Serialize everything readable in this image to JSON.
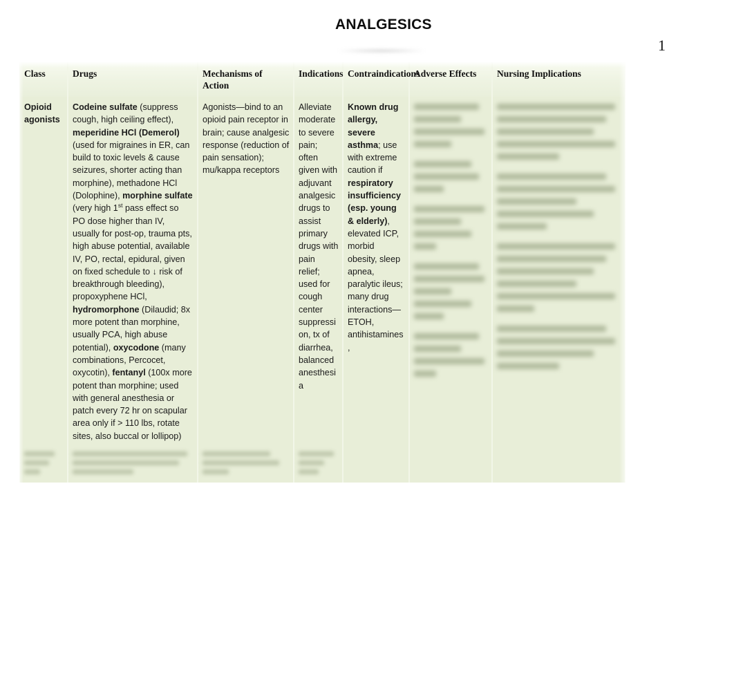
{
  "document": {
    "title": "ANALGESICS",
    "page_number": "1"
  },
  "table": {
    "headers": [
      "Class",
      "Drugs",
      "Mechanisms of Action",
      "Indications",
      "Contraindications",
      "Adverse Effects",
      "Nursing Implications"
    ],
    "rows": [
      {
        "class": "Opioid agonists",
        "drugs_segments": [
          {
            "text": "Codeine sulfate",
            "bold": true
          },
          {
            "text": " (suppress cough, high ceiling effect), ",
            "bold": false
          },
          {
            "text": "meperidine HCl (Demerol)",
            "bold": true
          },
          {
            "text": " (used for migraines in ER, can build to toxic levels & cause seizures, shorter acting than morphine), methadone HCl (Dolophine), ",
            "bold": false
          },
          {
            "text": "morphine sulfate",
            "bold": true
          },
          {
            "text": " (very high 1",
            "bold": false
          },
          {
            "text": "st",
            "bold": false,
            "sup": true
          },
          {
            "text": " pass effect so PO dose higher than IV, usually for post-op, trauma pts, high abuse potential, available IV, PO, rectal, epidural, given on fixed schedule to ↓ risk of breakthrough bleeding), propoxyphene HCl, ",
            "bold": false
          },
          {
            "text": "hydromorphone",
            "bold": true
          },
          {
            "text": " (Dilaudid; 8x more potent than morphine, usually PCA, high abuse potential), ",
            "bold": false
          },
          {
            "text": "oxycodone",
            "bold": true
          },
          {
            "text": " (many combinations, Percocet, oxycotin), ",
            "bold": false
          },
          {
            "text": "fentanyl",
            "bold": true
          },
          {
            "text": " (100x more potent than morphine; used with general anesthesia or patch every 72 hr on scapular area only if > 110 lbs, rotate sites, also buccal or lollipop)",
            "bold": false
          }
        ],
        "mechanisms": "Agonists—bind to an opioid pain receptor in brain; cause analgesic response (reduction of pain sensation); mu/kappa receptors",
        "indications": "Alleviate moderate to severe pain; often given with adjuvant analgesic drugs to assist primary drugs with pain relief; used for cough center suppression, tx of diarrhea, balanced anesthesia",
        "contraindications_segments": [
          {
            "text": "Known drug allergy, severe asthma",
            "bold": true
          },
          {
            "text": "; use with extreme caution if ",
            "bold": false
          },
          {
            "text": "respiratory insufficiency (esp. young & elderly)",
            "bold": true
          },
          {
            "text": ", elevated ICP, morbid obesity, sleep apnea, paralytic ileus; many drug interactions—ETOH, antihistamines,",
            "bold": false
          }
        ],
        "adverse_effects": "",
        "nursing_implications": ""
      }
    ],
    "illegible_note": ""
  },
  "colors": {
    "cell_background": "#e8eed8",
    "header_background": "#f2f6e8",
    "text": "#1a1a1a",
    "page_background": "#ffffff"
  }
}
